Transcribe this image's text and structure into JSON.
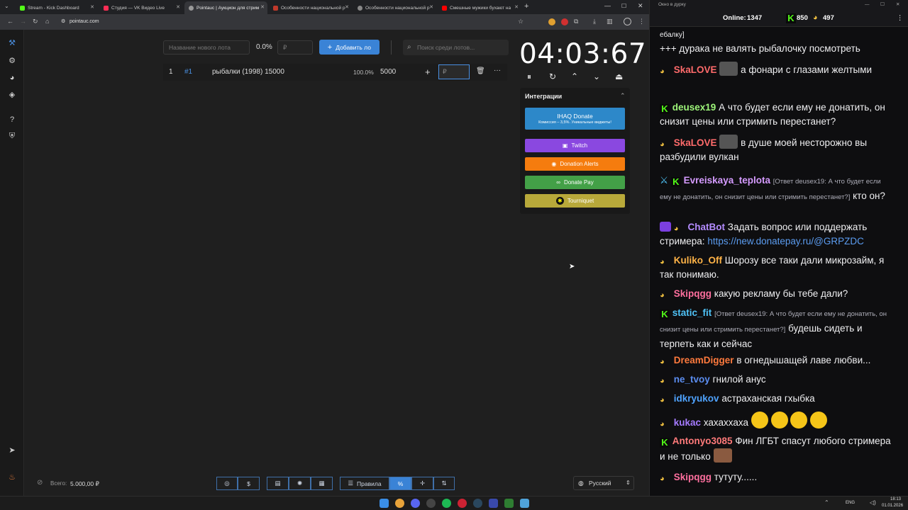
{
  "browser": {
    "tabs": [
      {
        "label": "Stream - Kick Dashboard",
        "color": "#53fc18"
      },
      {
        "label": "Студия — VK Видео Live",
        "color": "#ff2d55"
      },
      {
        "label": "Pointauc | Аукцион для стрим",
        "color": "#888888"
      },
      {
        "label": "Особенности национальной р",
        "color": "#c0392b"
      },
      {
        "label": "Особенности национальной р",
        "color": "#888888"
      },
      {
        "label": "Смешные мужики бухают на",
        "color": "#ff0000"
      }
    ],
    "url": "pointauc.com"
  },
  "app": {
    "new_lot_placeholder": "Название нового лота",
    "percent": "0.0%",
    "amount_placeholder": "₽",
    "add_button": "Добавить лот",
    "search_placeholder": "Поиск среди лотов...",
    "lots": [
      {
        "index": "1",
        "id": "#1",
        "name": "рыбалки (1998) 15000",
        "percent": "100.0%",
        "amount": "5000",
        "input_placeholder": "₽"
      }
    ],
    "timer": "04:03:67",
    "integrations": {
      "title": "Интеграции",
      "ihaq_title": "IHAQ Donate",
      "ihaq_sub": "Комиссия – 3,5%. Уникальные виджеты!",
      "twitch": "Twitch",
      "donation_alerts": "Donation Alerts",
      "donate_pay": "Donate Pay",
      "tourniquet": "Tourniquet"
    },
    "total_label": "Всего:",
    "total_value": "5.000,00 ₽",
    "rules_button": "Правила",
    "language": "Русский"
  },
  "chat": {
    "window_title": "Окно в дурку",
    "online_label": "Online:",
    "online_count": "1347",
    "kick_count": "850",
    "other_count": "497",
    "messages": [
      {
        "text": "ебалку]"
      },
      {
        "text": "+++ дурака не валять рыбалочку посмотреть"
      },
      {
        "nick": "SkaLOVE",
        "color": "#ff6b6b",
        "text": "а фонари с глазами желтыми"
      },
      {
        "nick": "deusex19",
        "color": "#9ef57a",
        "text": "А что будет если ему не донатить, он снизит цены или стримить перестанет?"
      },
      {
        "nick": "SkaLOVE",
        "color": "#ff6b6b",
        "text": "в душе моей несторожно вы разбудили вулкан"
      },
      {
        "nick": "Evreiskaya_teplota",
        "color": "#d59bff",
        "reply": "[Ответ deusex19: А что будет если ему не донатить, он снизит цены или стримить перестанет?]",
        "text": "кто он?"
      },
      {
        "nick": "ChatBot",
        "color": "#b48cff",
        "text": "Задать вопрос или поддержать стримера:",
        "link": "https://new.donatepay.ru/@GRPZDC"
      },
      {
        "nick": "Kuliko_Off",
        "color": "#ffb347",
        "text": "Шорозу все таки дали микрозайм, я так понимаю."
      },
      {
        "nick": "Skipqgg",
        "color": "#ff6f9e",
        "text": "какую рекламу бы тебе дали?"
      },
      {
        "nick": "static_fit",
        "color": "#4fc3f7",
        "reply": "[Ответ deusex19: А что будет если ему не донатить, он снизит цены или стримить перестанет?]",
        "text": "будешь сидеть и терпеть как и сейчас"
      },
      {
        "nick": "DreamDigger",
        "color": "#ff7a3d",
        "text": "в огнедышащей лаве любви..."
      },
      {
        "nick": "ne_tvoy",
        "color": "#5b8def",
        "text": "гнилой анус"
      },
      {
        "nick": "idkryukov",
        "color": "#4fa3ff",
        "text": "астраханская гхыбка"
      },
      {
        "nick": "kukac",
        "color": "#a57bff",
        "text": "хахаххаха"
      },
      {
        "nick": "Antonyo3085",
        "color": "#ff7a7a",
        "text": "Фин ЛГБТ спасут любого стримера и не только"
      },
      {
        "nick": "Skipqgg",
        "color": "#ff6f9e",
        "text": "тутуту......"
      }
    ]
  },
  "taskbar": {
    "lang": "ENG",
    "time": "18:13",
    "date": "01.01.2026"
  }
}
